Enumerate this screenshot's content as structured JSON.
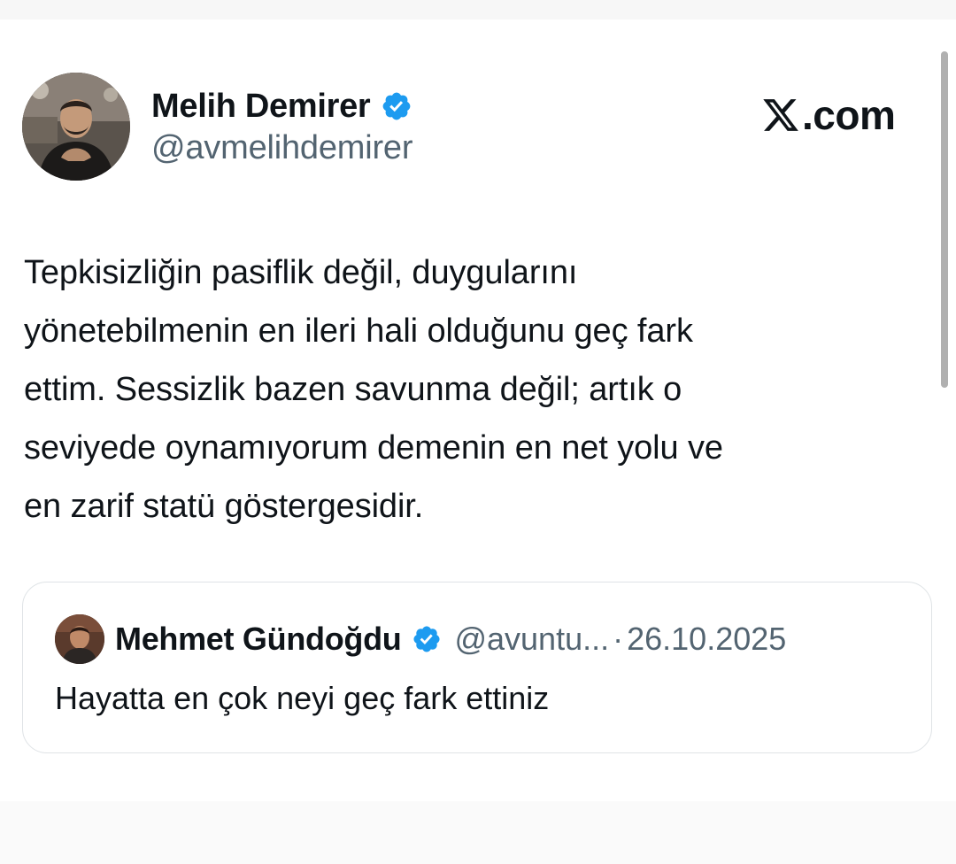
{
  "tweet": {
    "author": {
      "name": "Melih Demirer",
      "handle": "@avmelihdemirer",
      "verified": true
    },
    "site_label": ".com",
    "text": "Tepkisizliğin pasiflik değil, duygularını\nyönetebilmenin en ileri hali olduğunu geç fark\nettim. Sessizlik bazen savunma değil; artık o\nseviyede oynamıyorum demenin en net yolu ve\nen zarif statü göstergesidir."
  },
  "quoted_tweet": {
    "author": {
      "name": "Mehmet Gündoğdu",
      "handle": "@avuntu...",
      "verified": true
    },
    "separator": "·",
    "date": "26.10.2025",
    "text": "Hayatta en çok neyi geç fark ettiniz"
  },
  "colors": {
    "verified_blue": "#1d9bf0",
    "text_primary": "#0f1419",
    "text_secondary": "#536471",
    "card_border": "#dfe3e6"
  },
  "icons": {
    "verified": "verified-badge-icon",
    "x_logo": "x-logo-icon"
  }
}
